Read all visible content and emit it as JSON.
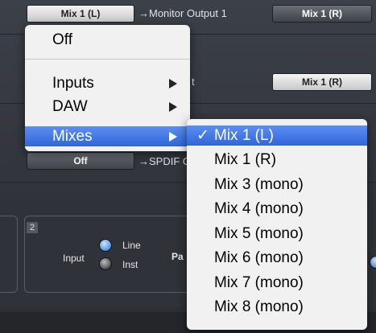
{
  "routing": {
    "row1": {
      "left_button": "Mix 1 (L)",
      "destination": "→Monitor Output 1",
      "right_button": "Mix 1 (R)"
    },
    "row2": {
      "destination_partial": "t",
      "right_button": "Mix 1 (R)"
    },
    "row3": {
      "left_button": "Off",
      "destination": "→SPDIF O"
    }
  },
  "channel": {
    "number": "2",
    "input_label": "Input",
    "line_label": "Line",
    "inst_label": "Inst",
    "pad_label": "Pa"
  },
  "source_menu": {
    "items": [
      {
        "label": "Off"
      },
      {
        "label": "Inputs"
      },
      {
        "label": "DAW"
      },
      {
        "label": "Mixes"
      }
    ]
  },
  "mixes_submenu": {
    "items": [
      {
        "label": "Mix 1 (L)",
        "checked": "✓"
      },
      {
        "label": "Mix 1 (R)"
      },
      {
        "label": "Mix 3 (mono)"
      },
      {
        "label": "Mix 4 (mono)"
      },
      {
        "label": "Mix 5 (mono)"
      },
      {
        "label": "Mix 6 (mono)"
      },
      {
        "label": "Mix 7 (mono)"
      },
      {
        "label": "Mix 8 (mono)"
      }
    ]
  },
  "colors": {
    "highlight": "#3a73e0",
    "menu_bg": "#f1f1f1"
  }
}
